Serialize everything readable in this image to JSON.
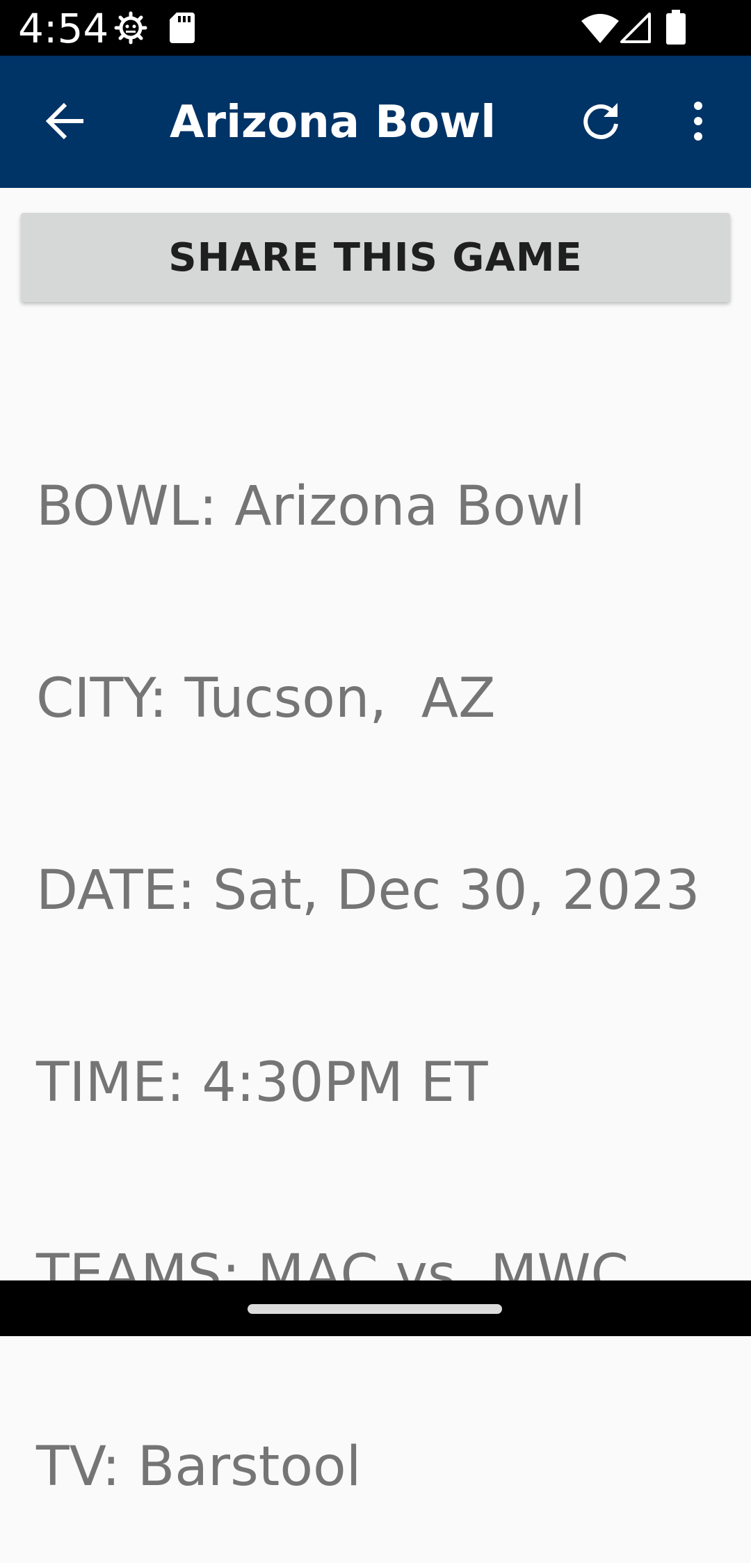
{
  "status_bar": {
    "time": "4:54",
    "icons": [
      "settings-gear-icon",
      "sd-card-icon",
      "wifi-icon",
      "cell-signal-icon",
      "battery-icon"
    ]
  },
  "app_bar": {
    "title": "Arizona Bowl",
    "background_color": "#003366",
    "back_icon": "arrow-left-icon",
    "refresh_icon": "refresh-icon",
    "menu_icon": "more-vert-icon"
  },
  "main": {
    "share_button_label": "SHARE THIS GAME",
    "details": {
      "bowl": "BOWL: Arizona Bowl",
      "city": "CITY: Tucson,  AZ",
      "date": "DATE: Sat, Dec 30, 2023",
      "time": "TIME: 4:30PM ET",
      "teams": "TEAMS: MAC vs. MWC",
      "tv": "TV: Barstool"
    }
  }
}
